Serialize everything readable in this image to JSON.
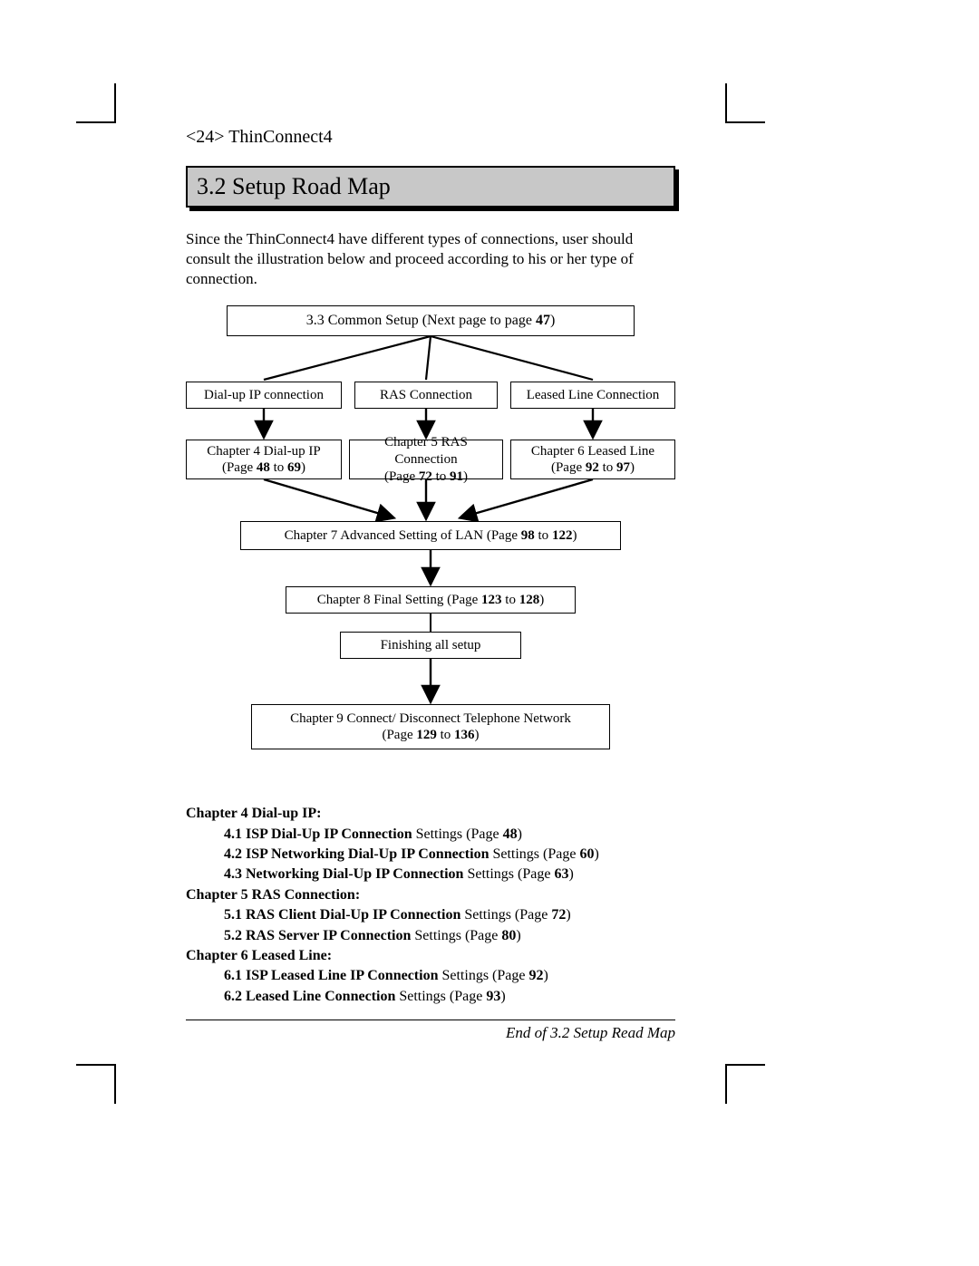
{
  "header": {
    "page_number": "<24>",
    "product": "ThinConnect4"
  },
  "section": {
    "number": "3.2",
    "title": "Setup Road Map"
  },
  "intro": "Since the ThinConnect4 have different types of connections, user should consult the illustration below and proceed according to his or her type of connection.",
  "diagram": {
    "common": {
      "prefix": "3.3 Common Setup (Next page to page ",
      "page": "47",
      "suffix": ")"
    },
    "branches": [
      {
        "label": "Dial-up IP connection"
      },
      {
        "label": "RAS Connection"
      },
      {
        "label": "Leased Line Connection"
      }
    ],
    "chapters": [
      {
        "title": "Chapter 4 Dial-up IP",
        "pages_pre": "(Page ",
        "p1": "48",
        "mid": " to ",
        "p2": "69",
        "post": ")"
      },
      {
        "title": "Chapter 5 RAS Connection",
        "pages_pre": "(Page ",
        "p1": "72",
        "mid": " to ",
        "p2": "91",
        "post": ")"
      },
      {
        "title": "Chapter 6 Leased Line",
        "pages_pre": "(Page ",
        "p1": "92",
        "mid": " to ",
        "p2": "97",
        "post": ")"
      }
    ],
    "ch7": {
      "pre": "Chapter 7 Advanced Setting of LAN (Page ",
      "p1": "98",
      "mid": " to ",
      "p2": "122",
      "post": ")"
    },
    "ch8": {
      "pre": "Chapter 8 Final Setting (Page ",
      "p1": "123",
      "mid": " to ",
      "p2": "128",
      "post": ")"
    },
    "finish": "Finishing all setup",
    "ch9": {
      "line1": "Chapter 9 Connect/ Disconnect Telephone Network",
      "pre": "(Page ",
      "p1": "129",
      "mid": " to ",
      "p2": "136",
      "post": ")"
    }
  },
  "toc": {
    "ch4": "Chapter 4 Dial-up IP:",
    "s41": {
      "t": "4.1 ISP Dial-Up IP Connection",
      "rest": " Settings (Page ",
      "p": "48",
      "post": ")"
    },
    "s42": {
      "t": "4.2 ISP Networking Dial-Up IP Connection",
      "rest": " Settings (Page ",
      "p": "60",
      "post": ")"
    },
    "s43": {
      "t": "4.3 Networking Dial-Up IP Connection",
      "rest": " Settings (Page ",
      "p": "63",
      "post": ")"
    },
    "ch5": "Chapter 5 RAS Connection:",
    "s51": {
      "t": "5.1 RAS Client Dial-Up IP Connection",
      "rest": " Settings (Page ",
      "p": "72",
      "post": ")"
    },
    "s52": {
      "t": "5.2 RAS Server IP Connection",
      "rest": " Settings (Page ",
      "p": "80",
      "post": ")"
    },
    "ch6": "Chapter 6 Leased Line:",
    "s61": {
      "t": "6.1 ISP Leased Line IP Connection",
      "rest": " Settings (Page ",
      "p": "92",
      "post": ")"
    },
    "s62": {
      "t": "6.2 Leased Line Connection",
      "rest": " Settings (Page ",
      "p": "93",
      "post": ")"
    }
  },
  "footer": "End of 3.2 Setup Read Map"
}
